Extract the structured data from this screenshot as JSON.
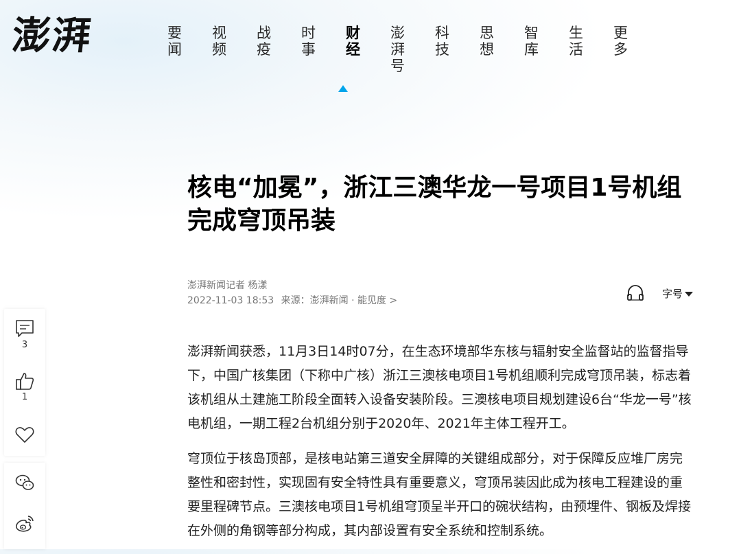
{
  "logo": {
    "text": "澎湃"
  },
  "nav": {
    "items": [
      "要闻",
      "视频",
      "战疫",
      "时事",
      "财经",
      "澎湃号",
      "科技",
      "思想",
      "智库",
      "生活",
      "更多"
    ],
    "active": "财经"
  },
  "article": {
    "title": "核电“加冕”，浙江三澳华龙一号项目1号机组完成穹顶吊装",
    "byline": "澎湃新闻记者 杨漾",
    "date": "2022-11-03 18:53",
    "source_label": "来源：",
    "source": "澎湃新闻 · 能见度 >",
    "paragraphs": [
      "澎湃新闻获悉，11月3日14时07分，在生态环境部华东核与辐射安全监督站的监督指导下，中国广核集团（下称中广核）浙江三澳核电项目1号机组顺利完成穹顶吊装，标志着该机组从土建施工阶段全面转入设备安装阶段。三澳核电项目规划建设6台“华龙一号”核电机组，一期工程2台机组分别于2020年、2021年主体工程开工。",
      "穹顶位于核岛顶部，是核电站第三道安全屏障的关键组成部分，对于保障反应堆厂房完整性和密封性，实现固有安全特性具有重要意义，穹顶吊装因此成为核电工程建设的重要里程碑节点。三澳核电项目1号机组穹顶呈半开口的碗状结构，由预埋件、钢板及焊接在外侧的角钢等部分构成，其内部设置有安全系统和控制系统。"
    ]
  },
  "tools": {
    "font_size_label": "字号",
    "listen_icon": "headphone-icon"
  },
  "sidebar": {
    "comment_count": "3",
    "like_count": "1"
  },
  "colors": {
    "accent": "#00a5eb",
    "text": "#222222",
    "meta": "#777777"
  }
}
